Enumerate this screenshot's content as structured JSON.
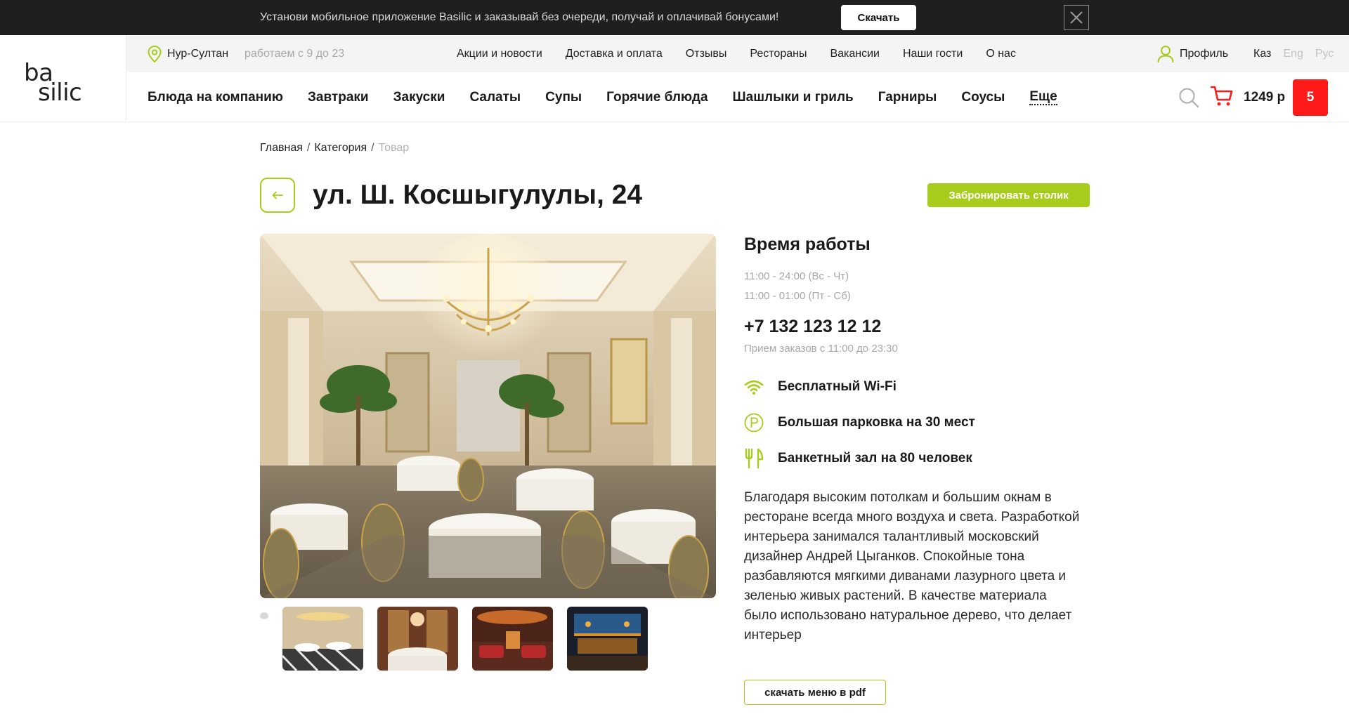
{
  "promo": {
    "text": "Установи мобильное приложение Basilic и заказывай без очереди, получай и оплачивай бонусами!",
    "download_label": "Скачать"
  },
  "logo": {
    "line1": "ba",
    "line2": "silic"
  },
  "subbar": {
    "city": "Нур-Султан",
    "hours": "работаем с 9 до 23",
    "links": [
      "Акции и новости",
      "Доставка и оплата",
      "Отзывы",
      "Рестораны",
      "Вакансии",
      "Наши гости",
      "О нас"
    ],
    "profile": "Профиль",
    "languages": [
      "Каз",
      "Eng",
      "Рус"
    ]
  },
  "categories": [
    "Блюда на компанию",
    "Завтраки",
    "Закуски",
    "Салаты",
    "Супы",
    "Горячие блюда",
    "Шашлыки и гриль",
    "Гарниры",
    "Соусы",
    "Еще"
  ],
  "cart": {
    "sum": "1249 р",
    "count": "5"
  },
  "breadcrumb": {
    "home": "Главная",
    "category": "Категория",
    "current": "Товар",
    "separator": "/"
  },
  "title": "ул. Ш. Косшыгулулы, 24",
  "book_label": "Забронировать столик",
  "info": {
    "hours_heading": "Время работы",
    "schedule": [
      "11:00 - 24:00 (Вс - Чт)",
      "11:00 - 01:00 (Пт - Сб)"
    ],
    "phone": "+7 132 123 12 12",
    "order_hours": "Прием заказов с 11:00 до 23:30",
    "features": [
      {
        "icon": "wifi-icon",
        "text": "Бесплатный Wi-Fi"
      },
      {
        "icon": "parking-icon",
        "text": "Большая парковка на 30 мест"
      },
      {
        "icon": "fork-knife-icon",
        "text": "Банкетный зал на 80 человек"
      }
    ],
    "description": "Благодаря высоким потолкам и большим окнам в ресторане всегда много воздуха и света. Разработкой интерьера занимался талантливый московский дизайнер Андрей Цыганков. Спокойные тона разбавляются мягкими диванами лазурного цвета и зеленью живых растений. В качестве материала было использовано натуральное дерево, что делает интерьер"
  },
  "pdf_label": "скачать меню в pdf",
  "colors": {
    "accent": "#a8cc1c",
    "cart_badge": "#ff1a1a",
    "banner": "#1f1f1f"
  }
}
